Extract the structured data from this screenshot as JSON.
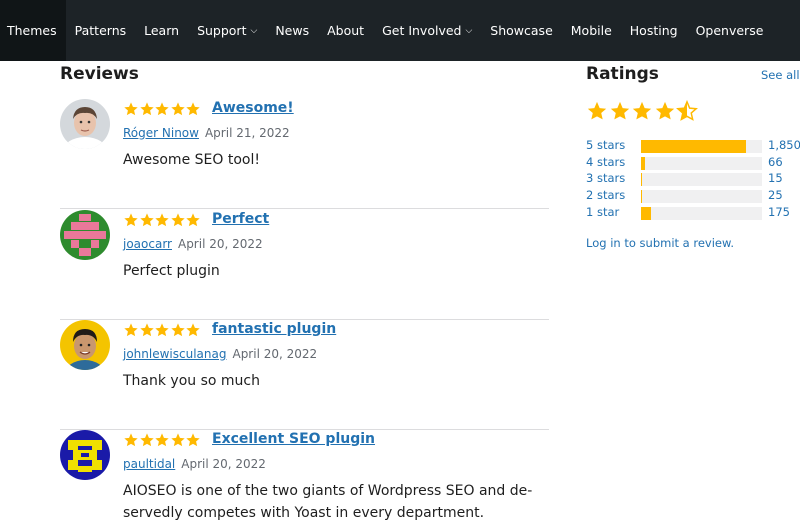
{
  "nav": {
    "items": [
      {
        "label": "Themes",
        "dropdown": false
      },
      {
        "label": "Patterns",
        "dropdown": false
      },
      {
        "label": "Learn",
        "dropdown": false
      },
      {
        "label": "Support",
        "dropdown": true
      },
      {
        "label": "News",
        "dropdown": false
      },
      {
        "label": "About",
        "dropdown": false
      },
      {
        "label": "Get Involved",
        "dropdown": true
      },
      {
        "label": "Showcase",
        "dropdown": false
      },
      {
        "label": "Mobile",
        "dropdown": false
      },
      {
        "label": "Hosting",
        "dropdown": false
      },
      {
        "label": "Openverse",
        "dropdown": false
      }
    ]
  },
  "reviews": {
    "heading": "Reviews",
    "items": [
      {
        "title": "Awesome!",
        "author": "Róger Ninow",
        "date": "April 21, 2022",
        "body": "Awesome SEO tool!",
        "stars": 5,
        "avatar_icon": "user-photo-avatar"
      },
      {
        "title": "Perfect",
        "author": "joaocarr",
        "date": "April 20, 2022",
        "body": "Perfect plugin",
        "stars": 5,
        "avatar_icon": "identicon-avatar"
      },
      {
        "title": "fantastic plugin",
        "author": "johnlewisculanag",
        "date": "April 20, 2022",
        "body": "Thank you so much",
        "stars": 5,
        "avatar_icon": "user-photo-avatar"
      },
      {
        "title": "Excellent SEO plugin",
        "author": "paultidal",
        "date": "April 20, 2022",
        "body": "AIOSEO is one of the two giants of Wordpress SEO and de-servedly competes with Yoast in every department.",
        "stars": 5,
        "avatar_icon": "identicon-avatar"
      }
    ]
  },
  "ratings": {
    "heading": "Ratings",
    "see_all": "See all",
    "average_stars": 4.5,
    "rows": [
      {
        "label": "5 stars",
        "count": "1,850",
        "fraction": 0.87
      },
      {
        "label": "4 stars",
        "count": "66",
        "fraction": 0.03
      },
      {
        "label": "3 stars",
        "count": "15",
        "fraction": 0.01
      },
      {
        "label": "2 stars",
        "count": "25",
        "fraction": 0.01
      },
      {
        "label": "1 star",
        "count": "175",
        "fraction": 0.08
      }
    ],
    "login_link": "Log in to submit a review."
  },
  "colors": {
    "nav_bg": "#1d2327",
    "link": "#2271b1",
    "star": "#ffb900",
    "bar_bg": "#f0f0f1"
  }
}
